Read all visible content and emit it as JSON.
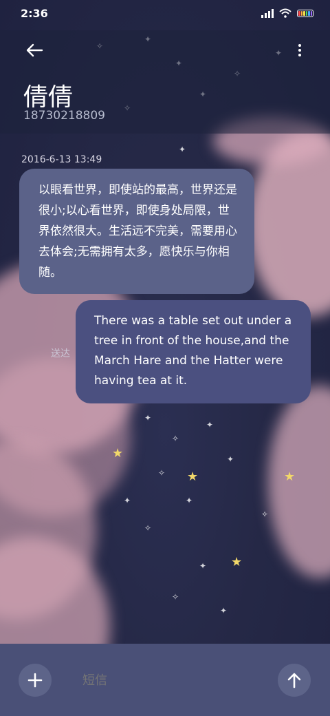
{
  "status_bar": {
    "time": "2:36",
    "signal_icon": "signal-icon",
    "wifi_icon": "wifi-icon",
    "battery_icon": "battery-icon",
    "battery_colors": [
      "#ff4b4b",
      "#ffb23e",
      "#f5e04a",
      "#4cd964",
      "#4aa8ff",
      "#a06cff"
    ]
  },
  "header": {
    "back_icon": "arrow-left-icon",
    "more_icon": "more-vertical-icon",
    "contact_name": "倩倩",
    "contact_number": "18730218809"
  },
  "conversation": {
    "timestamp": "2016-6-13 13:49",
    "messages": [
      {
        "direction": "incoming",
        "text": "以眼看世界，即使站的最高，世界还是很小;以心看世界，即使身处局限，世界依然很大。生活远不完美，需要用心去体会;无需拥有太多，愿快乐与你相随。"
      },
      {
        "direction": "outgoing",
        "text": "There was a table set out under a tree in front of the house,and the March Hare and the Hatter were having tea at it.",
        "status": "送达"
      }
    ]
  },
  "input_bar": {
    "add_icon": "plus-icon",
    "placeholder": "短信",
    "send_icon": "arrow-up-icon"
  },
  "colors": {
    "incoming_bubble": "#5b6289",
    "outgoing_bubble": "#4b5080",
    "input_bar": "#4a5077",
    "background": "#252846"
  }
}
